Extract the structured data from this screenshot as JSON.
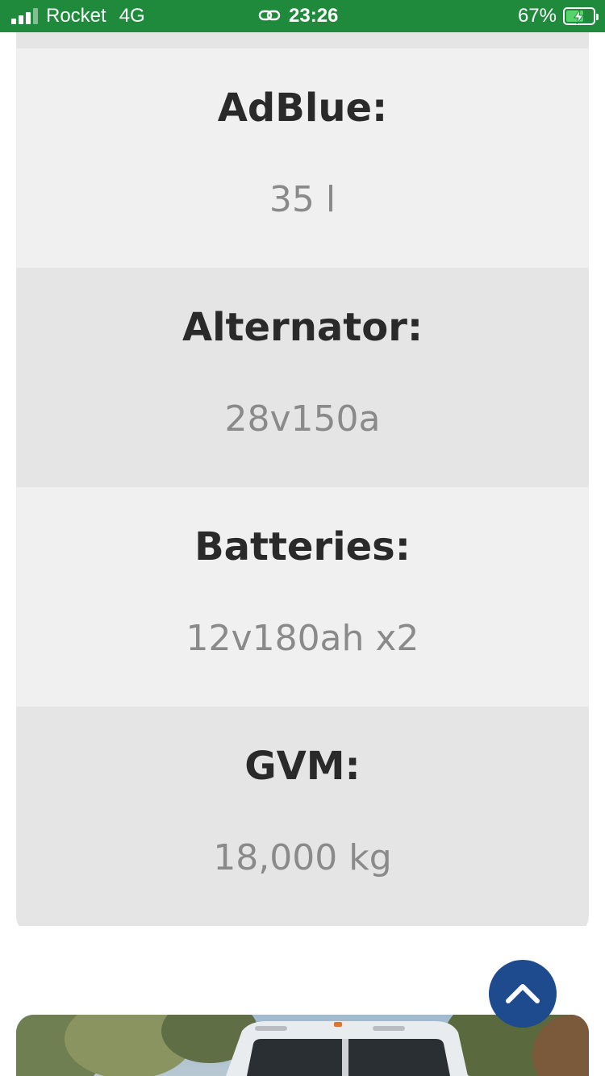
{
  "status_bar": {
    "carrier": "Rocket",
    "network": "4G",
    "time": "23:26",
    "battery_percent": "67%",
    "battery_level": 0.67,
    "background_color": "#1f8a3c"
  },
  "specs": [
    {
      "label": "AdBlue:",
      "value": "35 l"
    },
    {
      "label": "Alternator:",
      "value": "28v150a"
    },
    {
      "label": "Batteries:",
      "value": "12v180ah x2"
    },
    {
      "label": "GVM:",
      "value": "18,000 kg"
    }
  ],
  "back_to_top": {
    "icon": "chevron-up-icon",
    "color": "#1e4a8e"
  },
  "photo": {
    "subject": "bus-photo"
  }
}
